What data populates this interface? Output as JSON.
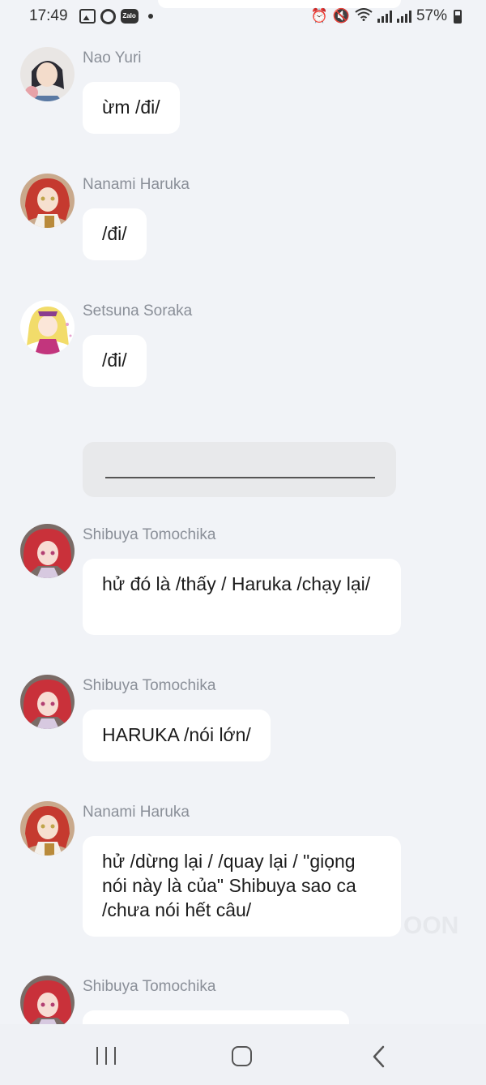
{
  "status_bar": {
    "time": "17:49",
    "notification_icons": [
      "image-icon",
      "circle-app-icon",
      "zalo-icon",
      "dot-icon"
    ],
    "zalo_label": "Zalo",
    "system_icons": [
      "alarm-icon",
      "mute-icon",
      "wifi-icon",
      "signal-icon",
      "signal-icon",
      "battery-icon"
    ],
    "battery": "57%"
  },
  "messages": [
    {
      "sender": "Nao Yuri",
      "text": "ừm /đi/"
    },
    {
      "sender": "Nanami Haruka",
      "text": "/đi/"
    },
    {
      "sender": "Setsuna Soraka",
      "text": "/đi/"
    },
    {
      "sender": "Shibuya Tomochika",
      "text": "hử đó là /thấy / Haruka /chạy lại/"
    },
    {
      "sender": "Shibuya Tomochika",
      "text": "HARUKA /nói lớn/"
    },
    {
      "sender": "Nanami Haruka",
      "text": "hử /dừng lại / /quay lại / \"giọng nói này là của\" Shibuya sao ca /chưa nói hết câu/"
    },
    {
      "sender": "Shibuya Tomochika",
      "text": ""
    }
  ],
  "watermark": "OON",
  "nav": {
    "icons": [
      "recent-apps-icon",
      "home-icon",
      "back-icon"
    ]
  },
  "colors": {
    "background": "#f1f3f7",
    "bubble": "#ffffff",
    "divider_bubble": "#e8e9eb",
    "sender_text": "#8a8f98"
  }
}
